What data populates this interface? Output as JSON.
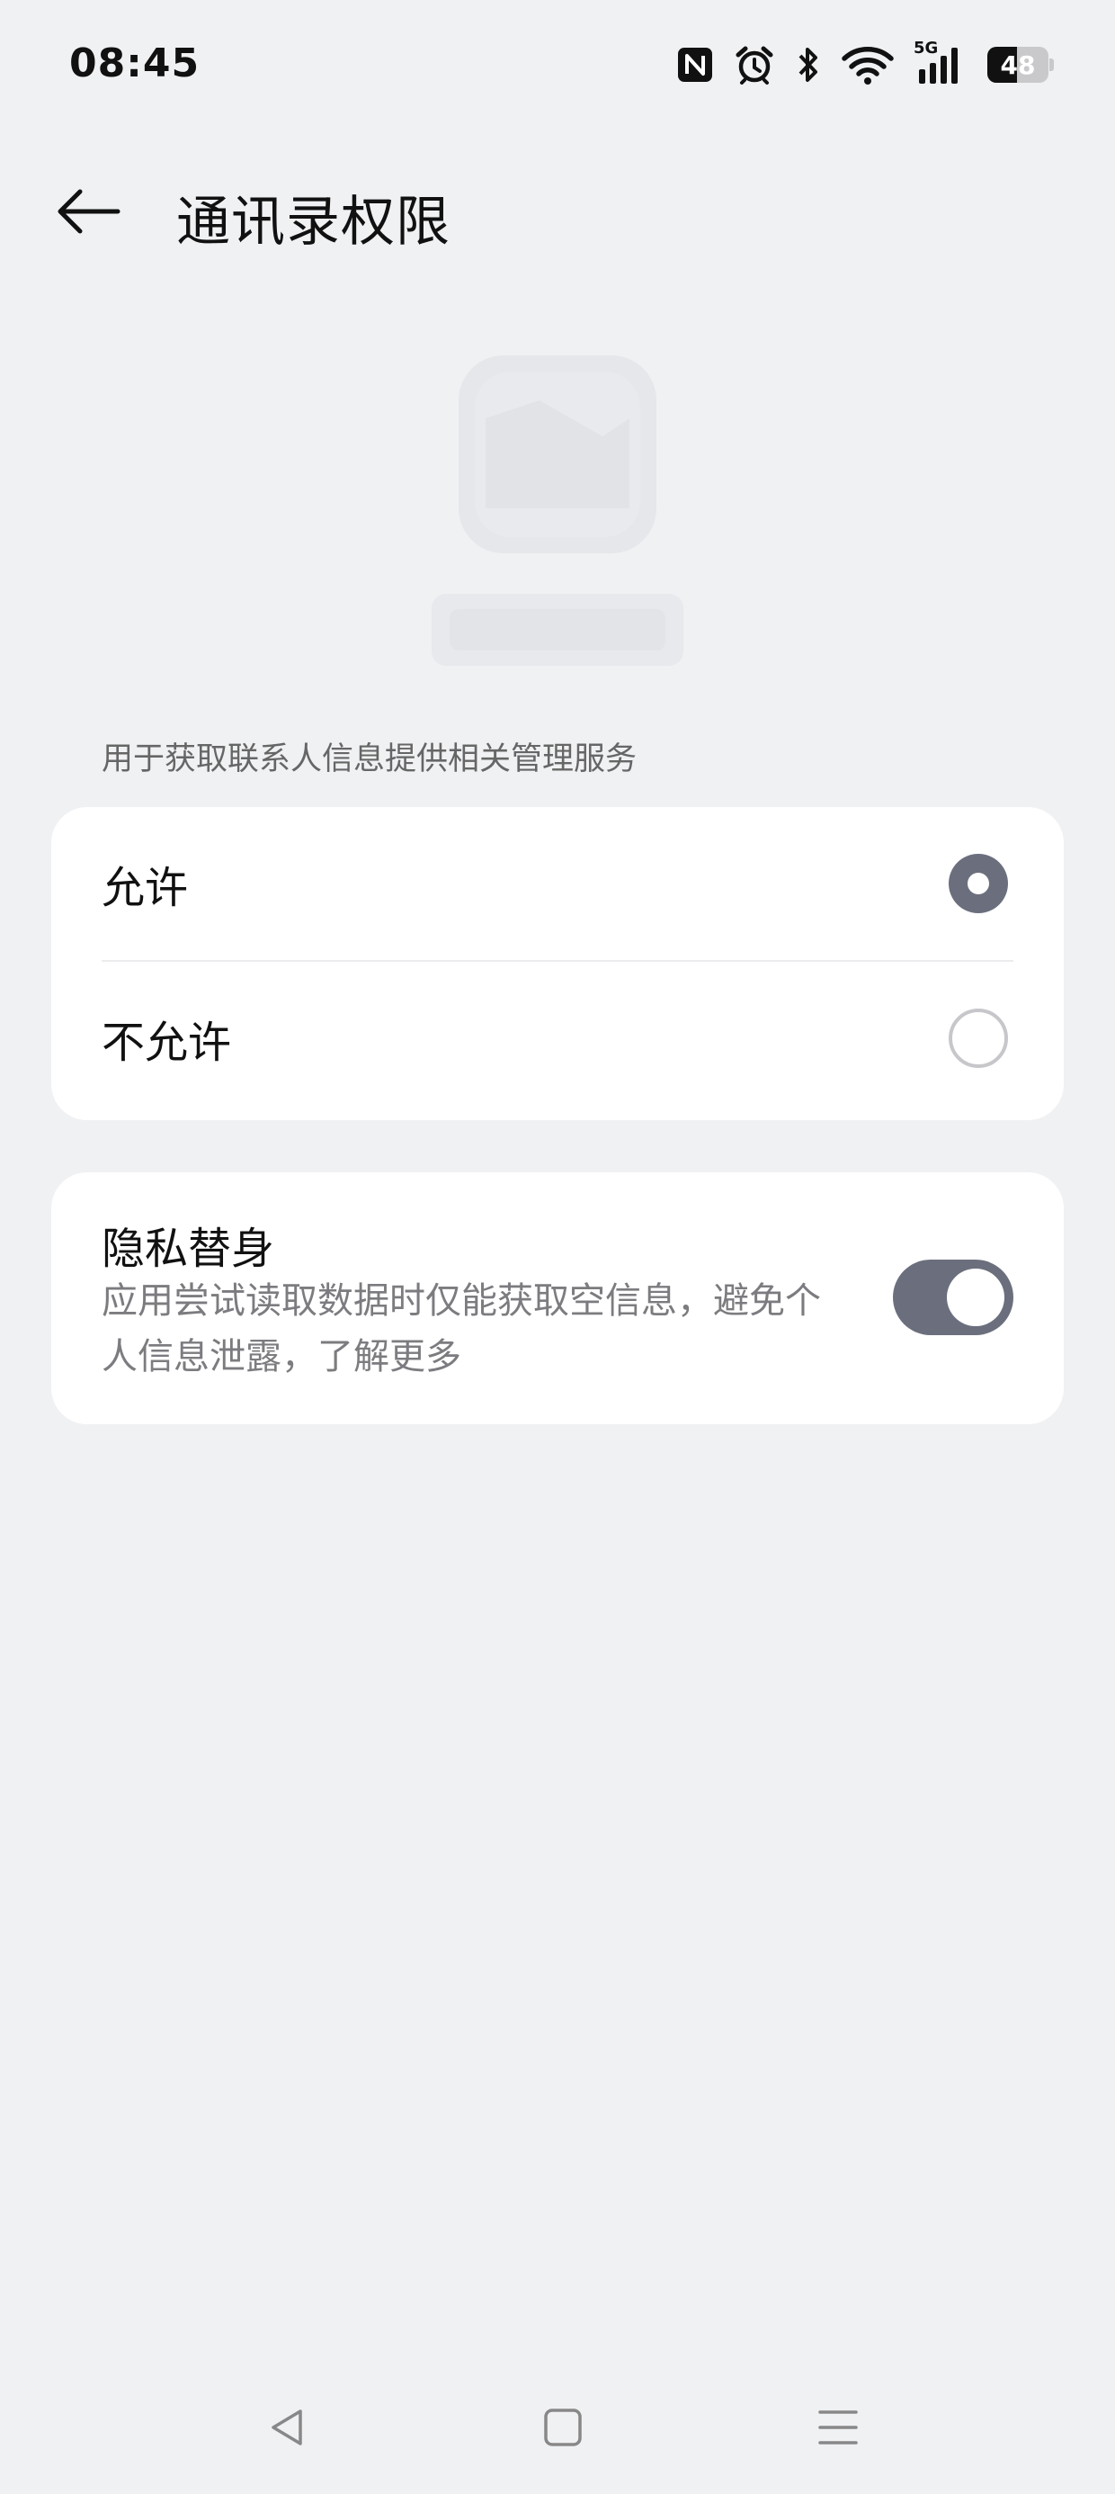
{
  "status_bar": {
    "time": "08:45",
    "network_label": "5G",
    "battery_level": "48",
    "battery_percent": 48,
    "icons": [
      "nfc-icon",
      "alarm-icon",
      "bluetooth-icon",
      "wifi-icon",
      "cellular-5g-icon",
      "battery-icon"
    ]
  },
  "header": {
    "title": "通讯录权限",
    "back_icon": "arrow-left-icon"
  },
  "app_icon": {
    "icon": "app-icon-faded"
  },
  "permissions": {
    "description": "用于获取联系人信息提供相关管理服务",
    "options": [
      {
        "label": "允许",
        "selected": true
      },
      {
        "label": "不允许",
        "selected": false
      }
    ]
  },
  "privacy_shield": {
    "title": "隐私替身",
    "description": "应用尝试读取数据时仅能获取空信息，避免个人信息泄露，了解更多",
    "enabled": true
  },
  "nav_bar": {
    "icons": [
      "nav-back-icon",
      "nav-home-icon",
      "nav-recents-icon"
    ]
  },
  "colors": {
    "background": "#f0f1f3",
    "card": "#ffffff",
    "accent": "#6b6f7d",
    "secondary_text": "#7c7c80"
  }
}
